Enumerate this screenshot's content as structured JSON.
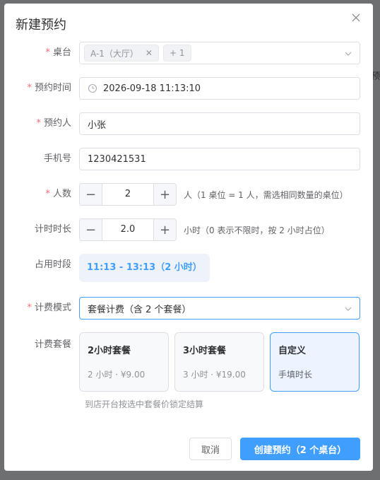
{
  "background_fragment": "预",
  "dialog": {
    "title": "新建预约",
    "fields": {
      "table": {
        "label": "桌台",
        "required": true,
        "tags": [
          {
            "text": "A-1（大厅）",
            "removable": true
          },
          {
            "text": "+ 1",
            "removable": false
          }
        ]
      },
      "time": {
        "label": "预约时间",
        "required": true,
        "value": "2026-09-18 11:13:10"
      },
      "person": {
        "label": "预约人",
        "required": true,
        "value": "小张"
      },
      "phone": {
        "label": "手机号",
        "required": false,
        "value": "1230421531"
      },
      "guests": {
        "label": "人数",
        "required": true,
        "value": "2",
        "hint": "人（1 桌位 = 1 人，需选相同数量的桌位）"
      },
      "duration": {
        "label": "计时时长",
        "required": false,
        "value": "2.0",
        "hint": "小时（0 表示不限时，按 2 小时占位）"
      },
      "period": {
        "label": "占用时段",
        "value": "11:13 - 13:13（2 小时）"
      },
      "billing": {
        "label": "计费模式",
        "required": true,
        "value": "套餐计费（含 2 个套餐）"
      },
      "packages": {
        "label": "计费套餐",
        "items": [
          {
            "name": "2小时套餐",
            "desc": "2 小时 · ¥9.00",
            "selected": false
          },
          {
            "name": "3小时套餐",
            "desc": "3 小时 · ¥19.00",
            "selected": false
          },
          {
            "name": "自定义",
            "desc": "手填时长",
            "selected": true
          }
        ],
        "hint": "到店开台按选中套餐价锁定结算"
      }
    },
    "buttons": {
      "cancel": "取消",
      "submit": "创建预约（2 个桌台）"
    },
    "required_mark": "*"
  },
  "stepper": {
    "minus": "−",
    "plus": "+"
  },
  "colors": {
    "primary": "#409eff",
    "required": "#f56c6c"
  }
}
